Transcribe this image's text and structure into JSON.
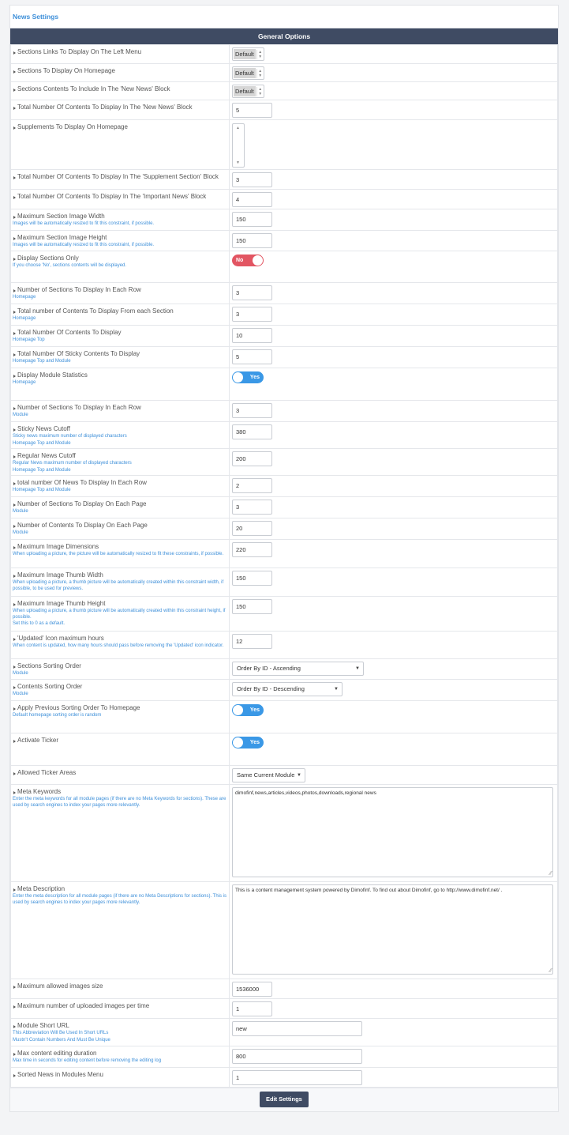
{
  "page_title": "News Settings",
  "section_title": "General Options",
  "rows": [
    {
      "label": "Sections Links To Display On The Left Menu",
      "help": [],
      "control": "spinner",
      "value": "Default",
      "h": 24
    },
    {
      "label": "Sections To Display On Homepage",
      "help": [],
      "control": "spinner",
      "value": "Default",
      "h": 23
    },
    {
      "label": "Sections Contents To Include In The 'New News' Block",
      "help": [],
      "control": "spinner",
      "value": "Default",
      "h": 23
    },
    {
      "label": "Total Number Of Contents To Display In The 'New News' Block",
      "help": [],
      "control": "text",
      "value": "5",
      "h": 24
    },
    {
      "label": "Supplements To Display On Homepage",
      "help": [],
      "control": "listbox",
      "value": "",
      "h": 60
    },
    {
      "label": "Total Number Of Contents To Display In The 'Supplement Section' Block",
      "help": [],
      "control": "text",
      "value": "3",
      "h": 24
    },
    {
      "label": "Total Number Of Contents To Display In The 'Important News' Block",
      "help": [],
      "control": "text",
      "value": "4",
      "h": 24
    },
    {
      "label": "Maximum Section Image Width",
      "help": [
        "Images will be automatically resized to fit this constraint, if possible."
      ],
      "control": "text",
      "value": "150",
      "h": 27
    },
    {
      "label": "Maximum Section Image Height",
      "help": [
        "Images will be automatically resized to fit this constraint, if possible."
      ],
      "control": "text",
      "value": "150",
      "h": 26
    },
    {
      "label": "Display Sections Only",
      "help": [
        "If you choose 'No', sections contents will be displayed."
      ],
      "control": "toggle",
      "value": "No",
      "on": false,
      "h": 40
    },
    {
      "label": "Number of Sections To Display In Each Row",
      "help": [
        "Homepage"
      ],
      "control": "text",
      "value": "3",
      "h": 27
    },
    {
      "label": "Total number of Contents To Display From each Section",
      "help": [
        "Homepage"
      ],
      "control": "text",
      "value": "3",
      "h": 27
    },
    {
      "label": "Total Number Of Contents To Display",
      "help": [
        "Homepage Top"
      ],
      "control": "text",
      "value": "10",
      "h": 27
    },
    {
      "label": "Total Number Of Sticky Contents To Display",
      "help": [
        "Homepage Top and Module"
      ],
      "control": "text",
      "value": "5",
      "h": 27
    },
    {
      "label": "Display Module Statistics",
      "help": [
        "Homepage"
      ],
      "control": "toggle",
      "value": "Yes",
      "on": true,
      "h": 41
    },
    {
      "label": "Number of Sections To Display In Each Row",
      "help": [
        "Module"
      ],
      "control": "text",
      "value": "3",
      "h": 27
    },
    {
      "label": "Sticky News Cutoff",
      "help": [
        "Sticky news maximum number of displayed characters",
        "Homepage Top and Module"
      ],
      "control": "text",
      "value": "380",
      "h": 34
    },
    {
      "label": "Regular News Cutoff",
      "help": [
        "Regular News maximum number of displayed characters",
        "Homepage Top and Module"
      ],
      "control": "text",
      "value": "200",
      "h": 34
    },
    {
      "label": "total number Of News To Display In Each Row",
      "help": [
        "Homepage Top and Module"
      ],
      "control": "text",
      "value": "2",
      "h": 27
    },
    {
      "label": "Number of Sections To Display On Each Page",
      "help": [
        "Module"
      ],
      "control": "text",
      "value": "3",
      "h": 27
    },
    {
      "label": "Number of Contents To Display On Each Page",
      "help": [
        "Module"
      ],
      "control": "text",
      "value": "20",
      "h": 27
    },
    {
      "label": "Maximum Image Dimensions",
      "help": [
        "When uploading a picture, the picture will be automatically resized to fit these constraints, if possible."
      ],
      "control": "text",
      "value": "220",
      "h": 36
    },
    {
      "label": "Maximum Image Thumb Width",
      "help": [
        "When uploading a picture, a thumb picture will be automatically created within this constraint width, if possible, to be used for previews."
      ],
      "control": "text",
      "value": "150",
      "h": 36
    },
    {
      "label": "Maximum Image Thumb Height",
      "help": [
        "When uploading a picture, a thumb picture will be automatically created within this constraint height, if possible.",
        "Set this to 0 as a default."
      ],
      "control": "text",
      "value": "150",
      "h": 44
    },
    {
      "label": "'Updated' Icon maximum hours",
      "help": [
        "When content is updated, how many hours should pass before removing the 'Updated' icon indicator."
      ],
      "control": "text",
      "value": "12",
      "h": 35
    },
    {
      "label": "Sections Sorting Order",
      "help": [
        "Module"
      ],
      "control": "select",
      "value": "Order By ID - Ascending",
      "w": 167,
      "h": 26
    },
    {
      "label": "Contents Sorting Order",
      "help": [
        "Module"
      ],
      "control": "select",
      "value": "Order By ID - Descending",
      "w": 140,
      "h": 27
    },
    {
      "label": "Apply Previous Sorting Order To Homepage",
      "help": [
        "Default homepage sorting order is random"
      ],
      "control": "toggle",
      "value": "Yes",
      "on": true,
      "h": 41
    },
    {
      "label": "Activate Ticker",
      "help": [],
      "control": "toggle",
      "value": "Yes",
      "on": true,
      "h": 41
    },
    {
      "label": "Allowed Ticker Areas",
      "help": [],
      "control": "select",
      "value": "Same Current Module",
      "w": 93,
      "h": 24
    },
    {
      "label": "Meta Keywords",
      "help": [
        "Enter the meta keywords for all module pages (if there are no Meta Keywords for sections). These are used by search engines to index your pages more relevantly."
      ],
      "control": "textarea",
      "value": "dimofinf,news,articles,videos,photos,downloads,regional news",
      "h": 123
    },
    {
      "label": "Meta Description",
      "help": [
        "Enter the meta description for all module pages (if there are no Meta Descriptions for sections). This is used by search engines to index your pages more relevantly."
      ],
      "control": "textarea",
      "value": "This is a content management system powered by Dimofinf. To find out about Dimofinf, go to http://www.dimofinf.net/ .",
      "h": 123
    },
    {
      "label": "Maximum allowed images size",
      "help": [],
      "control": "text",
      "value": "1536000",
      "h": 24
    },
    {
      "label": "Maximum number of uploaded images per time",
      "help": [],
      "control": "text",
      "value": "1",
      "h": 24
    },
    {
      "label": "Module Short URL",
      "help": [
        "This Abbreviation Will Be Used In Short URLs",
        "Mustn't Contain Numbers And Must Be Unique"
      ],
      "control": "text-wide",
      "value": "new",
      "h": 35
    },
    {
      "label": "Max content editing duration",
      "help": [
        "Max time in seconds for editing content before removing the editing log"
      ],
      "control": "text-wide",
      "value": "800",
      "h": 27
    },
    {
      "label": "Sorted News in Modules Menu",
      "help": [],
      "control": "text-wide",
      "value": "1",
      "h": 24
    }
  ],
  "footer": {
    "button_label": "Edit Settings"
  }
}
